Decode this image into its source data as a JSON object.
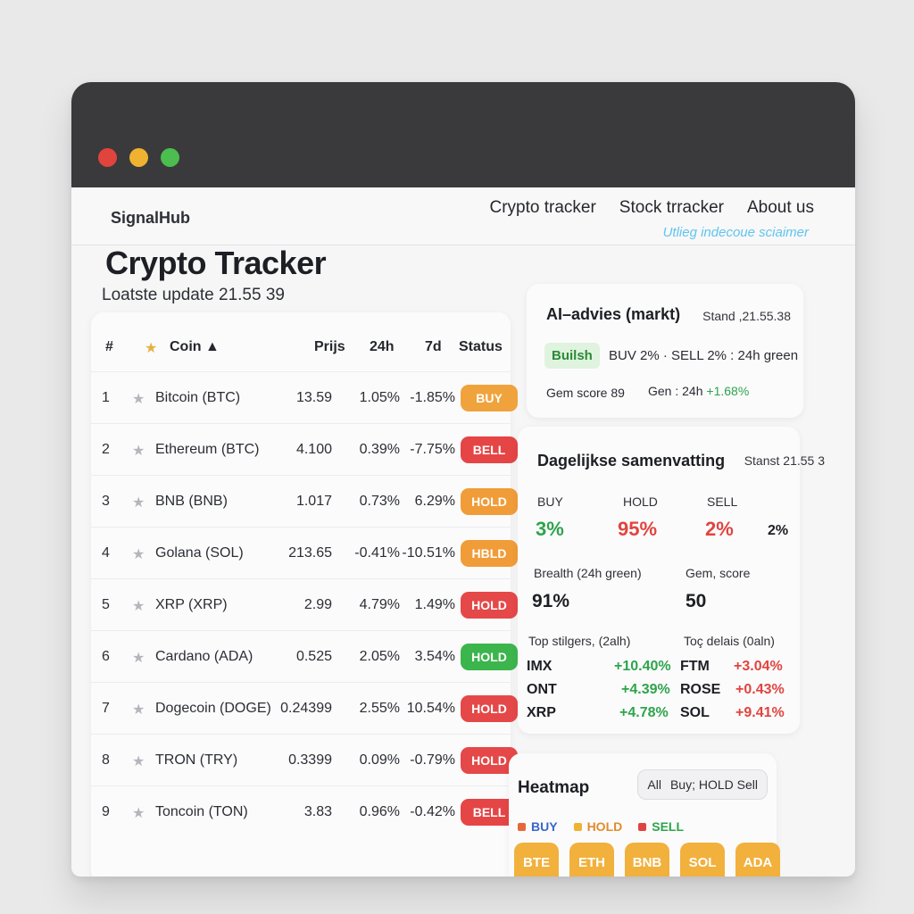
{
  "nav": {
    "brand": "SignalHub",
    "links": [
      "Crypto tracker",
      "Stock trracker",
      "About us"
    ],
    "disclaimer": "Utlieg indecoue sciaimer"
  },
  "page": {
    "title": "Crypto Tracker",
    "subtitle": "Loatste update 21.55 39"
  },
  "table": {
    "headers": {
      "num": "#",
      "coin": "Coin ▲",
      "price": "Prijs",
      "h24": "24h",
      "d7": "7d",
      "status": "Status"
    },
    "rows": [
      {
        "n": "1",
        "coin": "Bitcoin (BTC)",
        "price": "13.59",
        "h24": "1.05%",
        "d7": "-1.85%",
        "status": "BUY",
        "status_color": "#f0a33c"
      },
      {
        "n": "2",
        "coin": "Ethereum (BTC)",
        "price": "4.100",
        "h24": "0.39%",
        "d7": "-7.75%",
        "status": "BELL",
        "status_color": "#e54545"
      },
      {
        "n": "3",
        "coin": "BNB (BNB)",
        "price": "1.017",
        "h24": "0.73%",
        "d7": "6.29%",
        "status": "HOLD",
        "status_color": "#f09c38"
      },
      {
        "n": "4",
        "coin": "Golana (SOL)",
        "price": "213.65",
        "h24": "-0.41%",
        "d7": "-10.51%",
        "status": "HBLD",
        "status_color": "#f09c38"
      },
      {
        "n": "5",
        "coin": "XRP (XRP)",
        "price": "2.99",
        "h24": "4.79%",
        "d7": "1.49%",
        "status": "HOLD",
        "status_color": "#e54848"
      },
      {
        "n": "6",
        "coin": "Cardano (ADA)",
        "price": "0.525",
        "h24": "2.05%",
        "d7": "3.54%",
        "status": "HOLD",
        "status_color": "#3cb54c"
      },
      {
        "n": "7",
        "coin": "Dogecoin (DOGE)",
        "price": "0.24399",
        "h24": "2.55%",
        "d7": "10.54%",
        "status": "HOLD",
        "status_color": "#e54848"
      },
      {
        "n": "8",
        "coin": "TRON (TRY)",
        "price": "0.3399",
        "h24": "0.09%",
        "d7": "-0.79%",
        "status": "HOLD",
        "status_color": "#e54848"
      },
      {
        "n": "9",
        "coin": "Toncoin (TON)",
        "price": "3.83",
        "h24": "0.96%",
        "d7": "-0.42%",
        "status": "BELL",
        "status_color": "#e54545"
      }
    ]
  },
  "ai": {
    "title": "AI–advies (markt)",
    "stand": "Stand ,21.55.38",
    "tag": "Builsh",
    "line": "BUV 2% · SELL 2% : 24h green",
    "score": "Gem score 89",
    "gen_prefix": "Gen : 24h",
    "gen_value": "+1.68%"
  },
  "summary": {
    "title": "Dagelijkse samenvatting",
    "stand": "Stanst 21.55 3",
    "buy_label": "BUY",
    "buy_value": "3%",
    "hold_label": "HOLD",
    "hold_value": "95%",
    "sell_label": "SELL",
    "sell_value": "2%",
    "extra_value": "2%",
    "breadth_label": "Brealth (24h green)",
    "breadth_value": "91%",
    "score_label": "Gem, score",
    "score_value": "50",
    "gainers_label": "Top stilgers, (2alh)",
    "losers_label": "Toç delais (0aln)",
    "gainers": [
      {
        "sym": "IMX",
        "val": "+10.40%"
      },
      {
        "sym": "ONT",
        "val": "+4.39%"
      },
      {
        "sym": "XRP",
        "val": "+4.78%"
      }
    ],
    "losers": [
      {
        "sym": "FTM",
        "val": "+3.04%"
      },
      {
        "sym": "ROSE",
        "val": "+0.43%"
      },
      {
        "sym": "SOL",
        "val": "+9.41%"
      }
    ]
  },
  "heatmap": {
    "title": "Heatmap",
    "filter_all": "All",
    "filter_rest": "Buy; HOLD Sell",
    "legend_buy": "BUY",
    "legend_hold": "HOLD",
    "legend_sell": "SELL",
    "tiles": [
      "BTE",
      "ETH",
      "BNB",
      "SOL",
      "ADA"
    ]
  },
  "colors": {
    "accent_green": "#2ea44b",
    "accent_red": "#e1443f",
    "accent_orange": "#f0a33c"
  }
}
